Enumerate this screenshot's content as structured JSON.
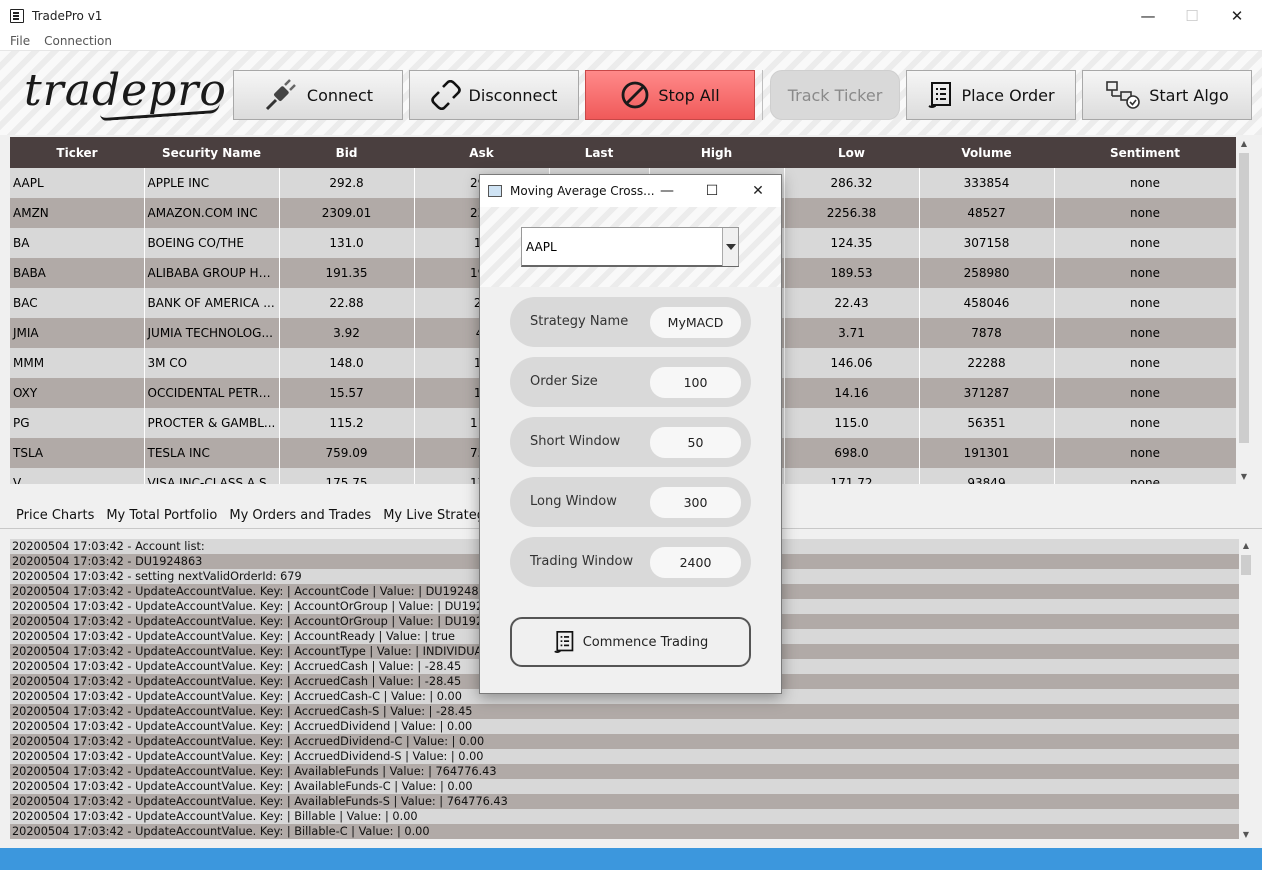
{
  "window": {
    "title": "TradePro v1",
    "minimize": "—",
    "maximize": "☐",
    "close": "✕"
  },
  "menu": [
    "File",
    "Connection"
  ],
  "logo": "tradepro",
  "toolbar": {
    "connect": "Connect",
    "disconnect": "Disconnect",
    "stop_all": "Stop All",
    "track_ticker": "Track Ticker",
    "place_order": "Place Order",
    "start_algo": "Start Algo"
  },
  "table": {
    "columns": [
      "Ticker",
      "Security Name",
      "Bid",
      "Ask",
      "Last",
      "High",
      "Low",
      "Volume",
      "Sentiment"
    ],
    "rows": [
      [
        "AAPL",
        "APPLE INC",
        "292.8",
        "292",
        "",
        "",
        "286.32",
        "333854",
        "none"
      ],
      [
        "AMZN",
        "AMAZON.COM INC",
        "2309.01",
        "231",
        "",
        "",
        "2256.38",
        "48527",
        "none"
      ],
      [
        "BA",
        "BOEING CO/THE",
        "131.0",
        "13",
        "",
        "",
        "124.35",
        "307158",
        "none"
      ],
      [
        "BABA",
        "ALIBABA GROUP HO...",
        "191.35",
        "191",
        "",
        "",
        "189.53",
        "258980",
        "none"
      ],
      [
        "BAC",
        "BANK OF AMERICA ...",
        "22.88",
        "22",
        "",
        "",
        "22.43",
        "458046",
        "none"
      ],
      [
        "JMIA",
        "JUMIA TECHNOLOG...",
        "3.92",
        "4.",
        "",
        "",
        "3.71",
        "7878",
        "none"
      ],
      [
        "MMM",
        "3M CO",
        "148.0",
        "14",
        "",
        "",
        "146.06",
        "22288",
        "none"
      ],
      [
        "OXY",
        "OCCIDENTAL PETRO...",
        "15.57",
        "15",
        "",
        "",
        "14.16",
        "371287",
        "none"
      ],
      [
        "PG",
        "PROCTER & GAMBL...",
        "115.2",
        "115",
        "",
        "",
        "115.0",
        "56351",
        "none"
      ],
      [
        "TSLA",
        "TESLA INC",
        "759.09",
        "759",
        "",
        "",
        "698.0",
        "191301",
        "none"
      ],
      [
        "V",
        "VISA INC-CLASS A S...",
        "175.75",
        "176",
        "",
        "",
        "171.72",
        "93849",
        "none"
      ]
    ]
  },
  "tabs": [
    "Price Charts",
    "My Total Portfolio",
    "My Orders and Trades",
    "My Live Strategies"
  ],
  "log": [
    "20200504 17:03:42 - Account list:",
    "20200504 17:03:42 - DU1924863",
    "20200504 17:03:42 - setting nextValidOrderId: 679",
    "20200504 17:03:42 - UpdateAccountValue. Key: | AccountCode | Value: | DU1924863",
    "20200504 17:03:42 - UpdateAccountValue. Key: | AccountOrGroup | Value: | DU1924863",
    "20200504 17:03:42 - UpdateAccountValue. Key: | AccountOrGroup | Value: | DU1924863",
    "20200504 17:03:42 - UpdateAccountValue. Key: | AccountReady | Value: | true",
    "20200504 17:03:42 - UpdateAccountValue. Key: | AccountType | Value: | INDIVIDUAL",
    "20200504 17:03:42 - UpdateAccountValue. Key: | AccruedCash | Value: | -28.45",
    "20200504 17:03:42 - UpdateAccountValue. Key: | AccruedCash | Value: | -28.45",
    "20200504 17:03:42 - UpdateAccountValue. Key: | AccruedCash-C | Value: | 0.00",
    "20200504 17:03:42 - UpdateAccountValue. Key: | AccruedCash-S | Value: | -28.45",
    "20200504 17:03:42 - UpdateAccountValue. Key: | AccruedDividend | Value: | 0.00",
    "20200504 17:03:42 - UpdateAccountValue. Key: | AccruedDividend-C | Value: | 0.00",
    "20200504 17:03:42 - UpdateAccountValue. Key: | AccruedDividend-S | Value: | 0.00",
    "20200504 17:03:42 - UpdateAccountValue. Key: | AvailableFunds | Value: | 764776.43",
    "20200504 17:03:42 - UpdateAccountValue. Key: | AvailableFunds-C | Value: | 0.00",
    "20200504 17:03:42 - UpdateAccountValue. Key: | AvailableFunds-S | Value: | 764776.43",
    "20200504 17:03:42 - UpdateAccountValue. Key: | Billable | Value: | 0.00",
    "20200504 17:03:42 - UpdateAccountValue. Key: | Billable-C | Value: | 0.00"
  ],
  "dialog": {
    "title": "Moving Average Cross...",
    "ticker": "AAPL",
    "fields": [
      {
        "label": "Strategy Name",
        "value": "MyMACD"
      },
      {
        "label": "Order Size",
        "value": "100"
      },
      {
        "label": "Short Window",
        "value": "50"
      },
      {
        "label": "Long Window",
        "value": "300"
      },
      {
        "label": "Trading Window",
        "value": "2400"
      }
    ],
    "commence": "Commence Trading"
  },
  "colors": {
    "stop_red": "#f26464",
    "header_dark": "#4a3f3f",
    "row_light": "#d8d8d8",
    "row_dark": "#b1aaa7",
    "status_blue": "#3c97dd"
  },
  "icons": [
    "plug-icon",
    "unlink-icon",
    "stop-icon",
    "document-list-icon",
    "flow-check-icon"
  ]
}
